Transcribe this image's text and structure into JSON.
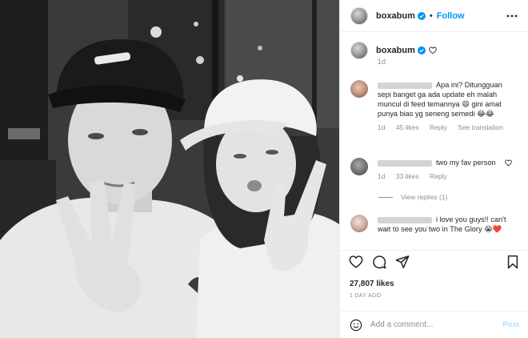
{
  "header": {
    "username": "boxabum",
    "separator": "•",
    "follow_label": "Follow",
    "more_icon": "more-horizontal-icon"
  },
  "caption": {
    "username": "boxabum",
    "time": "1d"
  },
  "comments": [
    {
      "text": "Apa ini? Ditungguan sepi banget ga ada update eh malah muncul di feed temannya 😄 gini amat punya bias yg seneng semedi 😂😂",
      "time": "1d",
      "likes": "45 likes",
      "reply": "Reply",
      "translation": "See translation"
    },
    {
      "text": "two my fav person",
      "time": "1d",
      "likes": "33 likes",
      "reply": "Reply",
      "view_replies": "View replies (1)"
    },
    {
      "text": "i love you guys!! can't wait to see you two in The Glory 😭❤️"
    }
  ],
  "likes_count": "27,807 likes",
  "posted_ago": "1 DAY AGO",
  "add_comment": {
    "placeholder": "Add a comment...",
    "post_label": "Post"
  },
  "colors": {
    "accent": "#0095f6",
    "post_disabled": "#b2dffc",
    "secondary_text": "#8e8e8e"
  }
}
